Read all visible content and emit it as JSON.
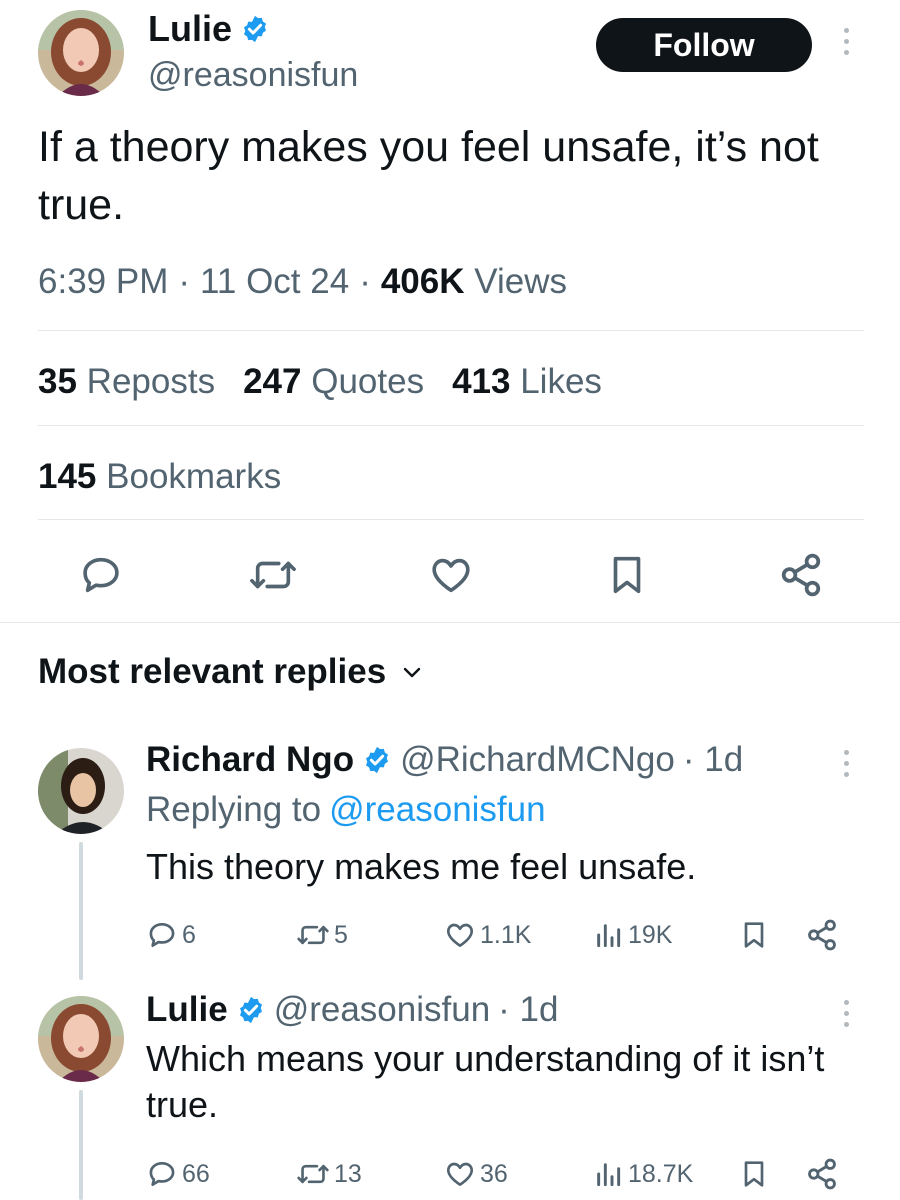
{
  "tweet": {
    "author": {
      "name": "Lulie",
      "handle": "@reasonisfun"
    },
    "follow_label": "Follow",
    "text": "If a theory makes you feel unsafe, it’s not true.",
    "time": "6:39 PM",
    "date": "11 Oct 24",
    "views_count": "406K",
    "views_label": "Views",
    "separator": "·",
    "stats": {
      "reposts_count": "35",
      "reposts_label": "Reposts",
      "quotes_count": "247",
      "quotes_label": "Quotes",
      "likes_count": "413",
      "likes_label": "Likes",
      "bookmarks_count": "145",
      "bookmarks_label": "Bookmarks"
    },
    "actions": [
      "reply-icon",
      "repost-icon",
      "like-icon",
      "bookmark-icon",
      "share-icon"
    ]
  },
  "replies_header": "Most relevant replies",
  "replies": [
    {
      "name": "Richard Ngo",
      "handle": "@RichardMCNgo",
      "age": "· 1d",
      "replying_prefix": "Replying to",
      "replying_to": "@reasonisfun",
      "text": "This theory makes me feel unsafe.",
      "stats": {
        "replies": "6",
        "reposts": "5",
        "likes": "1.1K",
        "views": "19K"
      }
    },
    {
      "name": "Lulie",
      "handle": "@reasonisfun",
      "age": "· 1d",
      "text": "Which means your understanding of it isn’t true.",
      "stats": {
        "replies": "66",
        "reposts": "13",
        "likes": "36",
        "views": "18.7K"
      }
    }
  ],
  "colors": {
    "text": "#0f1419",
    "muted": "#536471",
    "link": "#1d9bf0",
    "verified": "#1d9bf0",
    "follow_bg": "#0f1419",
    "divider": "#e5e8eb"
  }
}
